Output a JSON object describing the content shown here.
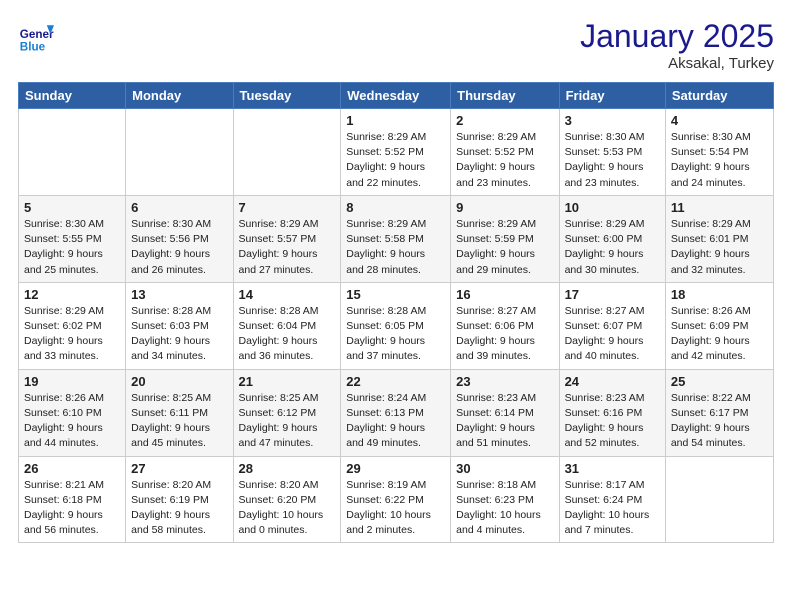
{
  "header": {
    "logo_line1": "General",
    "logo_line2": "Blue",
    "month": "January 2025",
    "location": "Aksakal, Turkey"
  },
  "weekdays": [
    "Sunday",
    "Monday",
    "Tuesday",
    "Wednesday",
    "Thursday",
    "Friday",
    "Saturday"
  ],
  "weeks": [
    [
      {
        "day": "",
        "info": ""
      },
      {
        "day": "",
        "info": ""
      },
      {
        "day": "",
        "info": ""
      },
      {
        "day": "1",
        "info": "Sunrise: 8:29 AM\nSunset: 5:52 PM\nDaylight: 9 hours\nand 22 minutes."
      },
      {
        "day": "2",
        "info": "Sunrise: 8:29 AM\nSunset: 5:52 PM\nDaylight: 9 hours\nand 23 minutes."
      },
      {
        "day": "3",
        "info": "Sunrise: 8:30 AM\nSunset: 5:53 PM\nDaylight: 9 hours\nand 23 minutes."
      },
      {
        "day": "4",
        "info": "Sunrise: 8:30 AM\nSunset: 5:54 PM\nDaylight: 9 hours\nand 24 minutes."
      }
    ],
    [
      {
        "day": "5",
        "info": "Sunrise: 8:30 AM\nSunset: 5:55 PM\nDaylight: 9 hours\nand 25 minutes."
      },
      {
        "day": "6",
        "info": "Sunrise: 8:30 AM\nSunset: 5:56 PM\nDaylight: 9 hours\nand 26 minutes."
      },
      {
        "day": "7",
        "info": "Sunrise: 8:29 AM\nSunset: 5:57 PM\nDaylight: 9 hours\nand 27 minutes."
      },
      {
        "day": "8",
        "info": "Sunrise: 8:29 AM\nSunset: 5:58 PM\nDaylight: 9 hours\nand 28 minutes."
      },
      {
        "day": "9",
        "info": "Sunrise: 8:29 AM\nSunset: 5:59 PM\nDaylight: 9 hours\nand 29 minutes."
      },
      {
        "day": "10",
        "info": "Sunrise: 8:29 AM\nSunset: 6:00 PM\nDaylight: 9 hours\nand 30 minutes."
      },
      {
        "day": "11",
        "info": "Sunrise: 8:29 AM\nSunset: 6:01 PM\nDaylight: 9 hours\nand 32 minutes."
      }
    ],
    [
      {
        "day": "12",
        "info": "Sunrise: 8:29 AM\nSunset: 6:02 PM\nDaylight: 9 hours\nand 33 minutes."
      },
      {
        "day": "13",
        "info": "Sunrise: 8:28 AM\nSunset: 6:03 PM\nDaylight: 9 hours\nand 34 minutes."
      },
      {
        "day": "14",
        "info": "Sunrise: 8:28 AM\nSunset: 6:04 PM\nDaylight: 9 hours\nand 36 minutes."
      },
      {
        "day": "15",
        "info": "Sunrise: 8:28 AM\nSunset: 6:05 PM\nDaylight: 9 hours\nand 37 minutes."
      },
      {
        "day": "16",
        "info": "Sunrise: 8:27 AM\nSunset: 6:06 PM\nDaylight: 9 hours\nand 39 minutes."
      },
      {
        "day": "17",
        "info": "Sunrise: 8:27 AM\nSunset: 6:07 PM\nDaylight: 9 hours\nand 40 minutes."
      },
      {
        "day": "18",
        "info": "Sunrise: 8:26 AM\nSunset: 6:09 PM\nDaylight: 9 hours\nand 42 minutes."
      }
    ],
    [
      {
        "day": "19",
        "info": "Sunrise: 8:26 AM\nSunset: 6:10 PM\nDaylight: 9 hours\nand 44 minutes."
      },
      {
        "day": "20",
        "info": "Sunrise: 8:25 AM\nSunset: 6:11 PM\nDaylight: 9 hours\nand 45 minutes."
      },
      {
        "day": "21",
        "info": "Sunrise: 8:25 AM\nSunset: 6:12 PM\nDaylight: 9 hours\nand 47 minutes."
      },
      {
        "day": "22",
        "info": "Sunrise: 8:24 AM\nSunset: 6:13 PM\nDaylight: 9 hours\nand 49 minutes."
      },
      {
        "day": "23",
        "info": "Sunrise: 8:23 AM\nSunset: 6:14 PM\nDaylight: 9 hours\nand 51 minutes."
      },
      {
        "day": "24",
        "info": "Sunrise: 8:23 AM\nSunset: 6:16 PM\nDaylight: 9 hours\nand 52 minutes."
      },
      {
        "day": "25",
        "info": "Sunrise: 8:22 AM\nSunset: 6:17 PM\nDaylight: 9 hours\nand 54 minutes."
      }
    ],
    [
      {
        "day": "26",
        "info": "Sunrise: 8:21 AM\nSunset: 6:18 PM\nDaylight: 9 hours\nand 56 minutes."
      },
      {
        "day": "27",
        "info": "Sunrise: 8:20 AM\nSunset: 6:19 PM\nDaylight: 9 hours\nand 58 minutes."
      },
      {
        "day": "28",
        "info": "Sunrise: 8:20 AM\nSunset: 6:20 PM\nDaylight: 10 hours\nand 0 minutes."
      },
      {
        "day": "29",
        "info": "Sunrise: 8:19 AM\nSunset: 6:22 PM\nDaylight: 10 hours\nand 2 minutes."
      },
      {
        "day": "30",
        "info": "Sunrise: 8:18 AM\nSunset: 6:23 PM\nDaylight: 10 hours\nand 4 minutes."
      },
      {
        "day": "31",
        "info": "Sunrise: 8:17 AM\nSunset: 6:24 PM\nDaylight: 10 hours\nand 7 minutes."
      },
      {
        "day": "",
        "info": ""
      }
    ]
  ],
  "row_classes": [
    "row-odd",
    "row-even",
    "row-odd",
    "row-even",
    "row-odd"
  ]
}
